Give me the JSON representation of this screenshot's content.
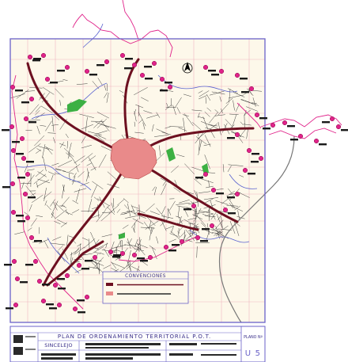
{
  "legend": {
    "title": "CONVENCIONES",
    "items": [
      {
        "swatch_color": "#6d1020",
        "label": ""
      },
      {
        "swatch_color": "#e98a8a",
        "label": ""
      }
    ]
  },
  "title_block": {
    "plan_title": "PLAN DE ORDENAMIENTO TERRITORIAL P.O.T.",
    "city": "SINCELEJO",
    "sheet_label": "PLANO Nº",
    "sheet_number": "U 5"
  },
  "map": {
    "colors": {
      "background": "#fdf8ea",
      "grid": "#f0b8c0",
      "frame": "#6a62c8",
      "streets": "#2a2a2a",
      "main_roads": "#6d1020",
      "center": "#e98a8a",
      "water": "#5a63d0",
      "perimeter": "#e0238a",
      "parks": "#3cb043",
      "highway": "#777777"
    }
  }
}
